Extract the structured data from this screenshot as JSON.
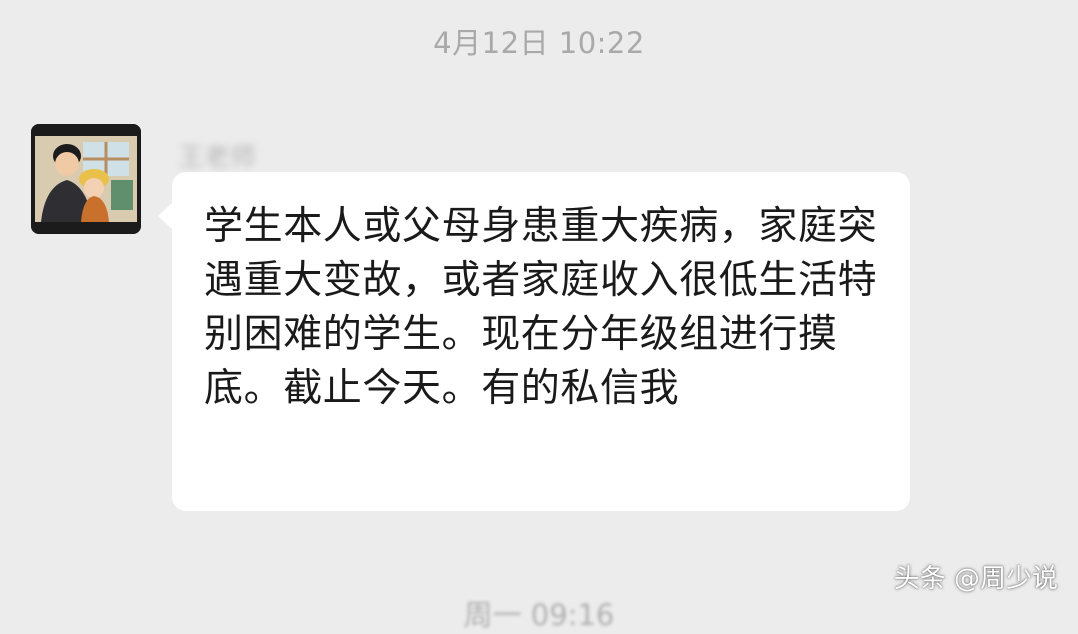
{
  "chat": {
    "timestamp": "4月12日 10:22",
    "next_timestamp": "周一 09:16"
  },
  "message": {
    "sender_name": "王老师",
    "avatar_icon": "user-avatar-illustration",
    "text": "学生本人或父母身患重大疾病，家庭突遇重大变故，或者家庭收入很低生活特别困难的学生。现在分年级组进行摸底。截止今天。有的私信我",
    "bubble_color": "#ffffff"
  },
  "watermark": {
    "text": "头条 @周少说"
  },
  "colors": {
    "background": "#ececec",
    "timestamp": "#a9a9a9",
    "message_text": "#1a1a1a"
  }
}
